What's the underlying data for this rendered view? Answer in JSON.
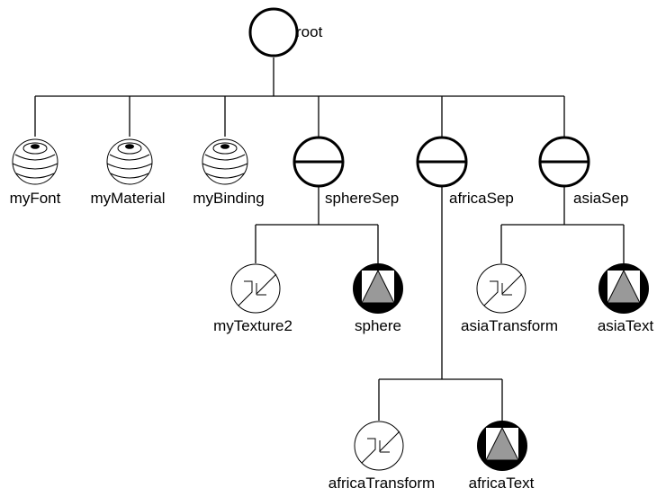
{
  "diagram": {
    "type": "scene-graph",
    "colors": {
      "line": "#000000",
      "fill_gray": "#999999",
      "background": "#ffffff"
    },
    "nodes": [
      {
        "id": "root",
        "label": "root",
        "kind": "group",
        "parent": null
      },
      {
        "id": "myFont",
        "label": "myFont",
        "kind": "property",
        "parent": "root"
      },
      {
        "id": "myMaterial",
        "label": "myMaterial",
        "kind": "property",
        "parent": "root"
      },
      {
        "id": "myBinding",
        "label": "myBinding",
        "kind": "property",
        "parent": "root"
      },
      {
        "id": "sphereSep",
        "label": "sphereSep",
        "kind": "separator",
        "parent": "root"
      },
      {
        "id": "africaSep",
        "label": "africaSep",
        "kind": "separator",
        "parent": "root"
      },
      {
        "id": "asiaSep",
        "label": "asiaSep",
        "kind": "separator",
        "parent": "root"
      },
      {
        "id": "myTexture2",
        "label": "myTexture2",
        "kind": "transform",
        "parent": "sphereSep"
      },
      {
        "id": "sphere",
        "label": "sphere",
        "kind": "shape",
        "parent": "sphereSep"
      },
      {
        "id": "asiaTransform",
        "label": "asiaTransform",
        "kind": "transform",
        "parent": "asiaSep"
      },
      {
        "id": "asiaText",
        "label": "asiaText",
        "kind": "shape",
        "parent": "asiaSep"
      },
      {
        "id": "africaTransform",
        "label": "africaTransform",
        "kind": "transform",
        "parent": "africaSep"
      },
      {
        "id": "africaText",
        "label": "africaText",
        "kind": "shape",
        "parent": "africaSep"
      }
    ]
  }
}
